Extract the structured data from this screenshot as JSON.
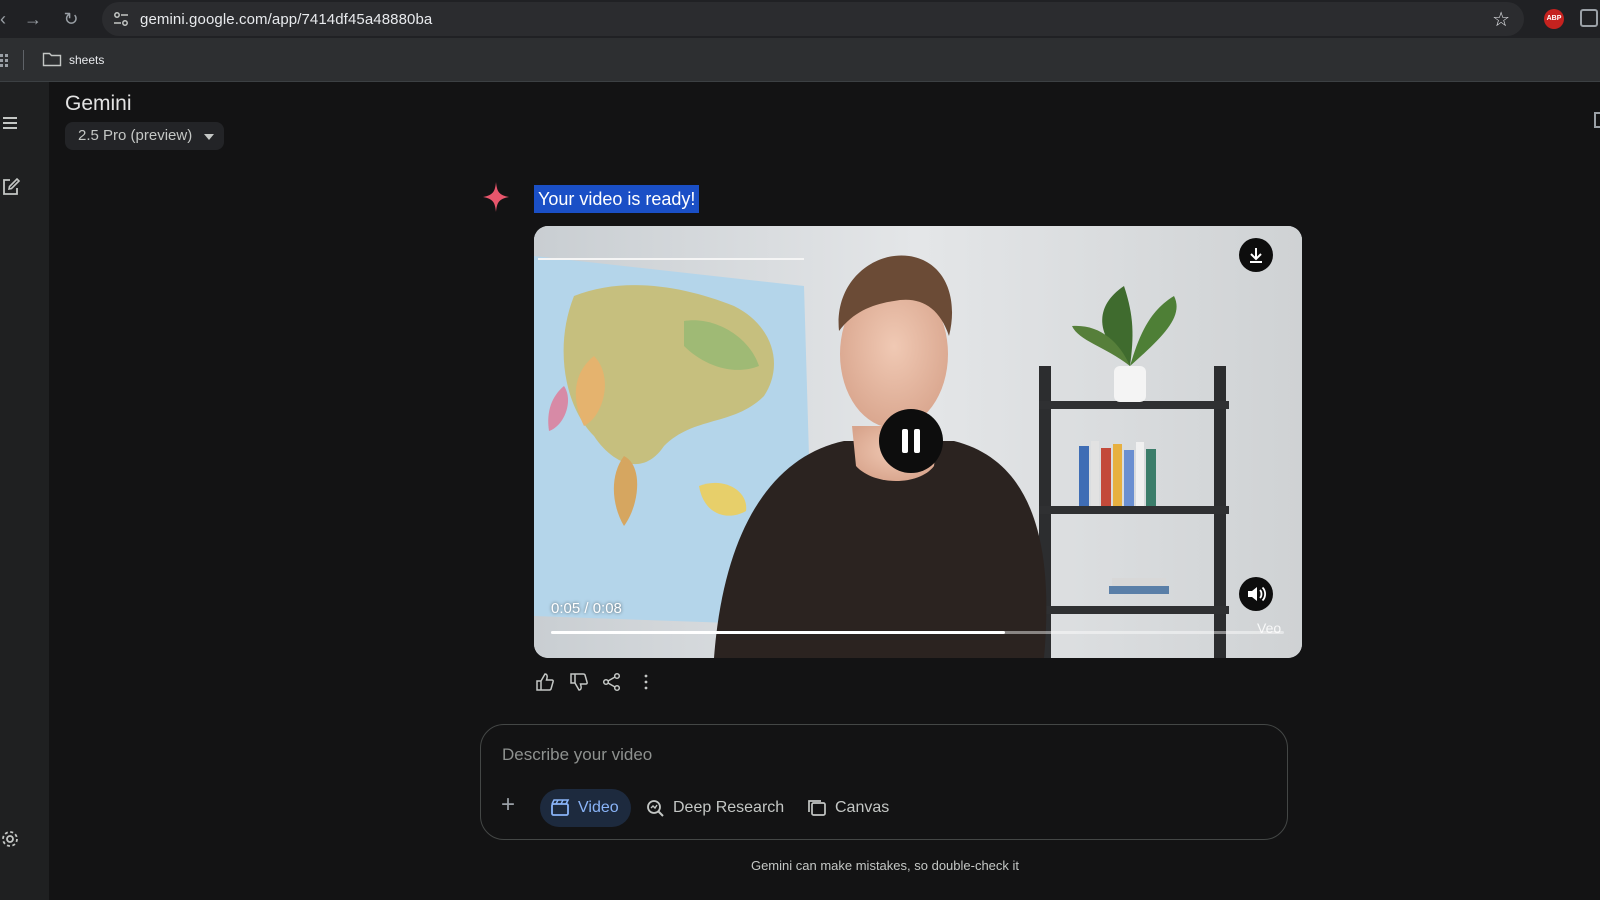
{
  "browser": {
    "url": "gemini.google.com/app/7414df45a48880ba",
    "bookmark_folder": "sheets",
    "extension_badge": "ABP"
  },
  "header": {
    "title": "Gemini",
    "model": "2.5 Pro (preview)"
  },
  "message": {
    "text": "Your video is ready!"
  },
  "video": {
    "time": "0:05 / 0:08",
    "progress": 0.62,
    "watermark": "Veo"
  },
  "composer": {
    "placeholder": "Describe your video",
    "tools": [
      {
        "label": "Video",
        "active": true
      },
      {
        "label": "Deep Research",
        "active": false
      },
      {
        "label": "Canvas",
        "active": false
      }
    ]
  },
  "footer": {
    "disclaimer": "Gemini can make mistakes, so double-check it"
  },
  "colors": {
    "accent": "#8ab4f8",
    "selection": "#1a4fc6",
    "spark": "#e8566c"
  }
}
